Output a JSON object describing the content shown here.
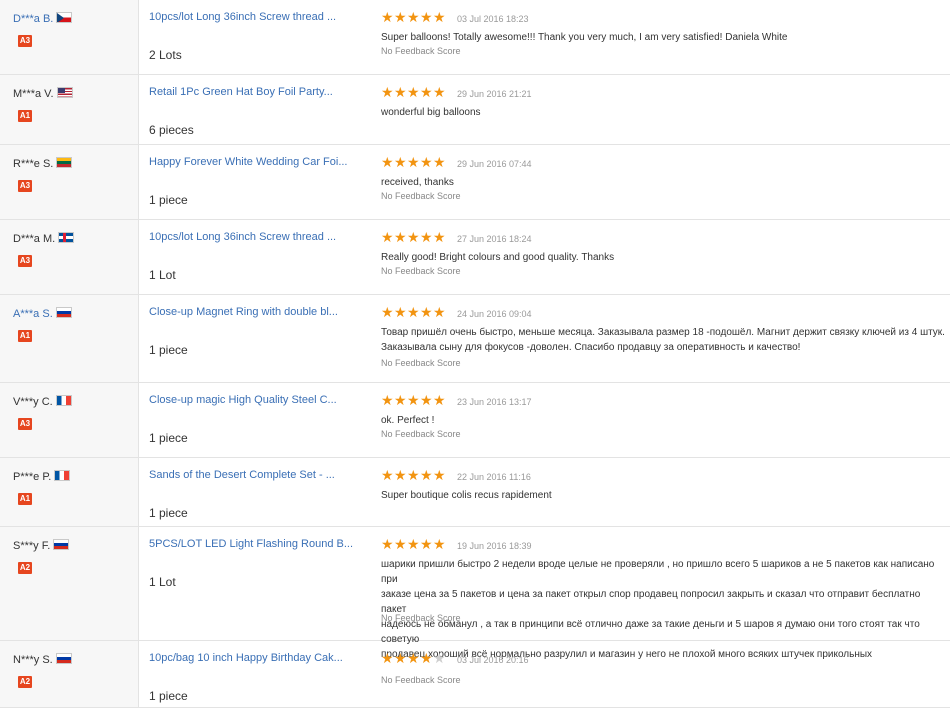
{
  "feedback_list": [
    {
      "buyer": "D***a B.",
      "buyer_link": true,
      "flag": "cz",
      "level": "A3",
      "product": "10pcs/lot Long 36inch Screw thread ...",
      "quantity": "2 Lots",
      "rating": 5,
      "date": "03 Jul 2016 18:23",
      "feedback": "Super balloons! Totally awesome!!! Thank you very much, I am very satisfied! Daniela White",
      "no_feedback_score": "No Feedback Score"
    },
    {
      "buyer": "M***a V.",
      "buyer_link": false,
      "flag": "us",
      "level": "A1",
      "product": "Retail 1Pc Green Hat Boy Foil Party...",
      "quantity": "6 pieces",
      "rating": 5,
      "date": "29 Jun 2016 21:21",
      "feedback": "wonderful big balloons",
      "no_feedback_score": ""
    },
    {
      "buyer": "R***e S.",
      "buyer_link": false,
      "flag": "lt",
      "level": "A3",
      "product": "Happy Forever White Wedding Car Foi...",
      "quantity": "1 piece",
      "rating": 5,
      "date": "29 Jun 2016 07:44",
      "feedback": "received, thanks",
      "no_feedback_score": "No Feedback Score"
    },
    {
      "buyer": "D***a M.",
      "buyer_link": false,
      "flag": "is",
      "level": "A3",
      "product": "10pcs/lot Long 36inch Screw thread ...",
      "quantity": "1 Lot",
      "rating": 5,
      "date": "27 Jun 2016 18:24",
      "feedback": "Really good! Bright colours and good quality. Thanks",
      "no_feedback_score": "No Feedback Score"
    },
    {
      "buyer": "A***a S.",
      "buyer_link": true,
      "flag": "ru",
      "level": "A1",
      "product": "Close-up Magnet Ring with double bl...",
      "quantity": "1 piece",
      "rating": 5,
      "date": "24 Jun 2016 09:04",
      "feedback": "Товар пришёл очень быстро, меньше месяца. Заказывала размер 18 -подошёл. Магнит держит связку ключей из 4 штук.\nЗаказывала сыну для фокусов -доволен. Спасибо продавцу за оперативность и качество!",
      "no_feedback_score": "No Feedback Score"
    },
    {
      "buyer": "V***y C.",
      "buyer_link": false,
      "flag": "fr",
      "level": "A3",
      "product": "Close-up magic High Quality Steel C...",
      "quantity": "1 piece",
      "rating": 5,
      "date": "23 Jun 2016 13:17",
      "feedback": "ok. Perfect !",
      "no_feedback_score": "No Feedback Score"
    },
    {
      "buyer": "P***e P.",
      "buyer_link": false,
      "flag": "fr",
      "level": "A1",
      "product": "Sands of the Desert Complete Set - ...",
      "quantity": "1 piece",
      "rating": 5,
      "date": "22 Jun 2016 11:16",
      "feedback": "Super boutique colis recus rapidement",
      "no_feedback_score": ""
    },
    {
      "buyer": "S***y F.",
      "buyer_link": false,
      "flag": "ru",
      "level": "A2",
      "product": "5PCS/LOT LED Light Flashing Round B...",
      "quantity": "1 Lot",
      "rating": 5,
      "date": "19 Jun 2016 18:39",
      "feedback": "шарики пришли быстро 2 недели вроде целые не проверяли , но пришло всего 5 шариков а не 5 пакетов как написано при\nзаказе цена за 5 пакетов и цена за пакет открыл спор продавец попросил закрыть и сказал что отправит бесплатно пакет\nнадеюсь не обманул , а так в принципи всё отлично даже за такие деньги и 5 шаров я думаю они того стоят так что советую\nпродавец хороший всё нормально разрулил и магазин у него не плохой много всяких штучек прикольных",
      "no_feedback_score": "No Feedback Score"
    },
    {
      "buyer": "N***y S.",
      "buyer_link": false,
      "flag": "ru",
      "level": "A2",
      "product": "10pc/bag 10 inch Happy Birthday Cak...",
      "quantity": "1 piece",
      "rating": 4,
      "date": "03 Jul 2016 20:16",
      "feedback": "",
      "no_feedback_score": "No Feedback Score"
    }
  ]
}
